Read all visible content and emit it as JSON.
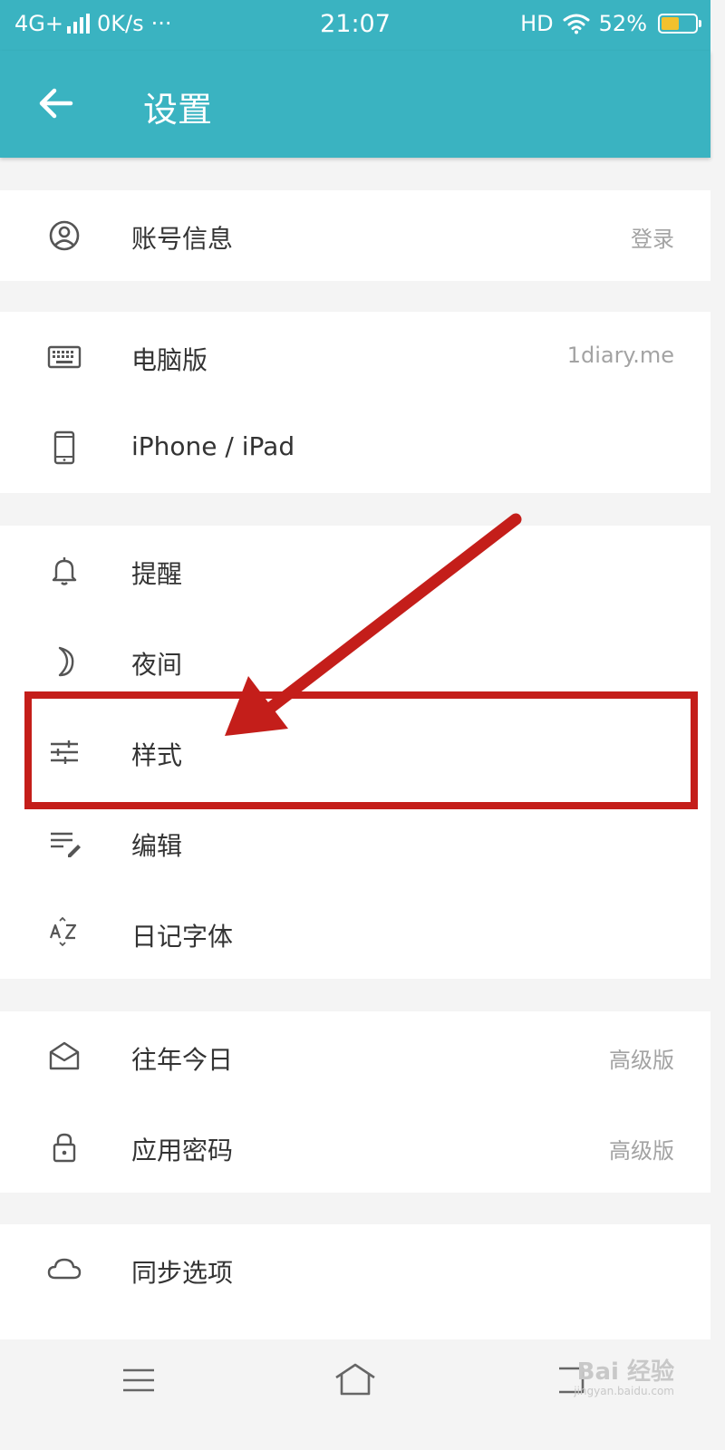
{
  "status_bar": {
    "network": "4G+",
    "speed": "0K/s",
    "more": "···",
    "time": "21:07",
    "hd": "HD",
    "battery_percent": "52%",
    "battery_level": 0.52
  },
  "header": {
    "title": "设置",
    "back_icon": "arrow-left-icon"
  },
  "groups": [
    [
      {
        "icon": "account-circle-icon",
        "label": "账号信息",
        "value": "登录"
      }
    ],
    [
      {
        "icon": "keyboard-icon",
        "label": "电脑版",
        "value": "1diary.me"
      },
      {
        "icon": "phone-icon",
        "label": "iPhone / iPad",
        "value": ""
      }
    ],
    [
      {
        "icon": "bell-icon",
        "label": "提醒",
        "value": ""
      },
      {
        "icon": "moon-icon",
        "label": "夜间",
        "value": ""
      },
      {
        "icon": "sliders-icon",
        "label": "样式",
        "value": ""
      },
      {
        "icon": "edit-list-icon",
        "label": "编辑",
        "value": ""
      },
      {
        "icon": "font-az-icon",
        "label": "日记字体",
        "value": ""
      }
    ],
    [
      {
        "icon": "envelope-open-icon",
        "label": "往年今日",
        "value": "高级版"
      },
      {
        "icon": "lock-icon",
        "label": "应用密码",
        "value": "高级版"
      }
    ],
    [
      {
        "icon": "cloud-icon",
        "label": "同步选项",
        "value": ""
      }
    ]
  ],
  "nav_bar": {
    "menu_icon": "menu-icon",
    "home_icon": "home-icon",
    "back_icon": "back-nav-icon"
  },
  "watermark": {
    "brand": "Bai 经验",
    "url": "jingyan.baidu.com"
  },
  "colors": {
    "primary": "#3ab3c1",
    "annotation": "#c41e1a",
    "text": "#333333",
    "secondary_text": "#a3a3a3",
    "background": "#f4f4f4"
  }
}
